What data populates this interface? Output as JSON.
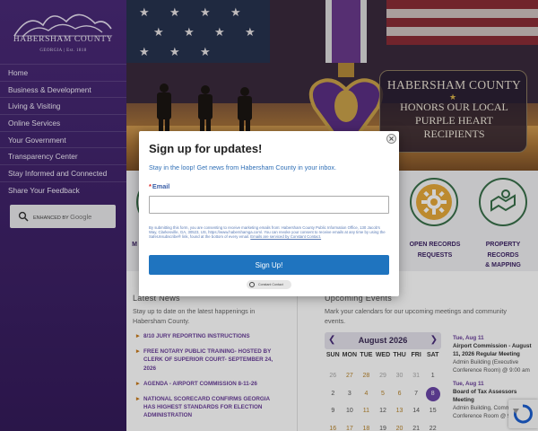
{
  "sidebar": {
    "logo_name": "HABERSHAM COUNTY",
    "logo_sub": "GEORGIA | Est. 1818",
    "nav": [
      {
        "label": "Home"
      },
      {
        "label": "Business & Development"
      },
      {
        "label": "Living & Visiting"
      },
      {
        "label": "Online Services"
      },
      {
        "label": "Your Government"
      },
      {
        "label": "Transparency Center"
      },
      {
        "label": "Stay Informed and Connected"
      },
      {
        "label": "Share Your Feedback"
      }
    ],
    "search_enhanced": "ENHANCED BY",
    "search_google": "Google"
  },
  "hero": {
    "county": "HABERSHAM COUNTY",
    "line1": "HONORS OUR LOCAL",
    "line2": "PURPLE HEART",
    "line3": "RECIPIENTS"
  },
  "quick_links": {
    "left_partial": "M",
    "open_records_1": "OPEN RECORDS",
    "open_records_2": "REQUESTS",
    "property_1": "PROPERTY",
    "property_2": "RECORDS",
    "property_3": "& MAPPING"
  },
  "news": {
    "heading": "Latest News",
    "desc": "Stay up to date on the latest happenings in Habersham County.",
    "items": [
      {
        "title": "8/10 JURY REPORTING INSTRUCTIONS"
      },
      {
        "title": "FREE NOTARY PUBLIC TRAINING- HOSTED BY CLERK OF SUPERIOR COURT- SEPTEMBER 24, 2026"
      },
      {
        "title": "AGENDA - AIRPORT COMMISSION 8-11-26"
      },
      {
        "title": "NATIONAL SCORECARD CONFIRMS GEORGIA HAS HIGHEST STANDARDS FOR ELECTION ADMINISTRATION"
      }
    ]
  },
  "events": {
    "heading": "Upcoming Events",
    "desc": "Mark your calendars for our upcoming meetings and community events.",
    "calendar": {
      "month": "August 2026",
      "dow": [
        "SUN",
        "MON",
        "TUE",
        "WED",
        "THU",
        "FRI",
        "SAT"
      ],
      "week1": [
        "26",
        "27",
        "28",
        "29",
        "30",
        "31",
        "1"
      ],
      "week2": [
        "2",
        "3",
        "4",
        "5",
        "6",
        "7",
        "8"
      ],
      "week3": [
        "9",
        "10",
        "11",
        "12",
        "13",
        "14",
        "15"
      ],
      "week4": [
        "16",
        "17",
        "18",
        "19",
        "20",
        "21",
        "22"
      ]
    },
    "list": [
      {
        "date": "Tue, Aug 11",
        "title": "Airport Commission - August 11, 2026 Regular Meeting",
        "loc": "Admin Building (Executive Conference Room) @ 9:00 am"
      },
      {
        "date": "Tue, Aug 11",
        "title": "Board of Tax Assessors Meeting",
        "loc": "Admin Building, Community Conference Room @ 9:00 am"
      }
    ]
  },
  "modal": {
    "title": "Sign up for updates!",
    "subtitle": "Stay in the loop! Get news from Habersham County in your inbox.",
    "email_label": "Email",
    "email_value": "",
    "legal": "By submitting this form, you are consenting to receive marketing emails from: Habersham County Public Information Office, 130 Jacob's Way, Clarkesville, GA, 30523, US, https://www.habershamga.com/. You can revoke your consent to receive emails at any time by using the SafeUnsubscribe® link, found at the bottom of every email.",
    "legal_link": "Emails are serviced by Constant Contact.",
    "submit": "Sign Up!",
    "badge": "Constant Contact"
  },
  "colors": {
    "sidebar": "#3d2166",
    "accent_purple": "#6a3f9a",
    "accent_green": "#39704a",
    "button_blue": "#1f74bf"
  }
}
